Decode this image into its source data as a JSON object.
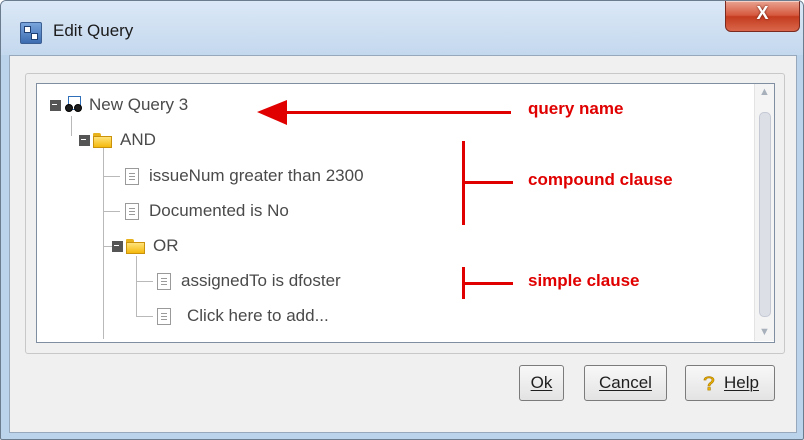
{
  "window": {
    "title": "Edit Query",
    "close_glyph": "X",
    "app_icon": "query-editor-icon"
  },
  "tree": {
    "root": {
      "label": "New Query 3",
      "icon": "binoculars-query-icon",
      "expanded": true
    },
    "and_node": {
      "label": "AND",
      "icon": "folder-icon",
      "expanded": true
    },
    "clause_issuenum": {
      "label": "issueNum greater than 2300",
      "icon": "document-icon"
    },
    "clause_documented": {
      "label": "Documented is No",
      "icon": "document-icon"
    },
    "or_node": {
      "label": "OR",
      "icon": "folder-icon",
      "expanded": true
    },
    "clause_assigned": {
      "label": "assignedTo is dfoster",
      "icon": "document-icon"
    },
    "add_clause": {
      "label": "Click here to add...",
      "icon": "document-icon"
    }
  },
  "buttons": {
    "ok": "Ok",
    "cancel": "Cancel",
    "help": "Help"
  },
  "annotations": {
    "query_name": "query name",
    "compound_clause": "compound clause",
    "simple_clause": "simple clause",
    "color": "#e00000"
  }
}
